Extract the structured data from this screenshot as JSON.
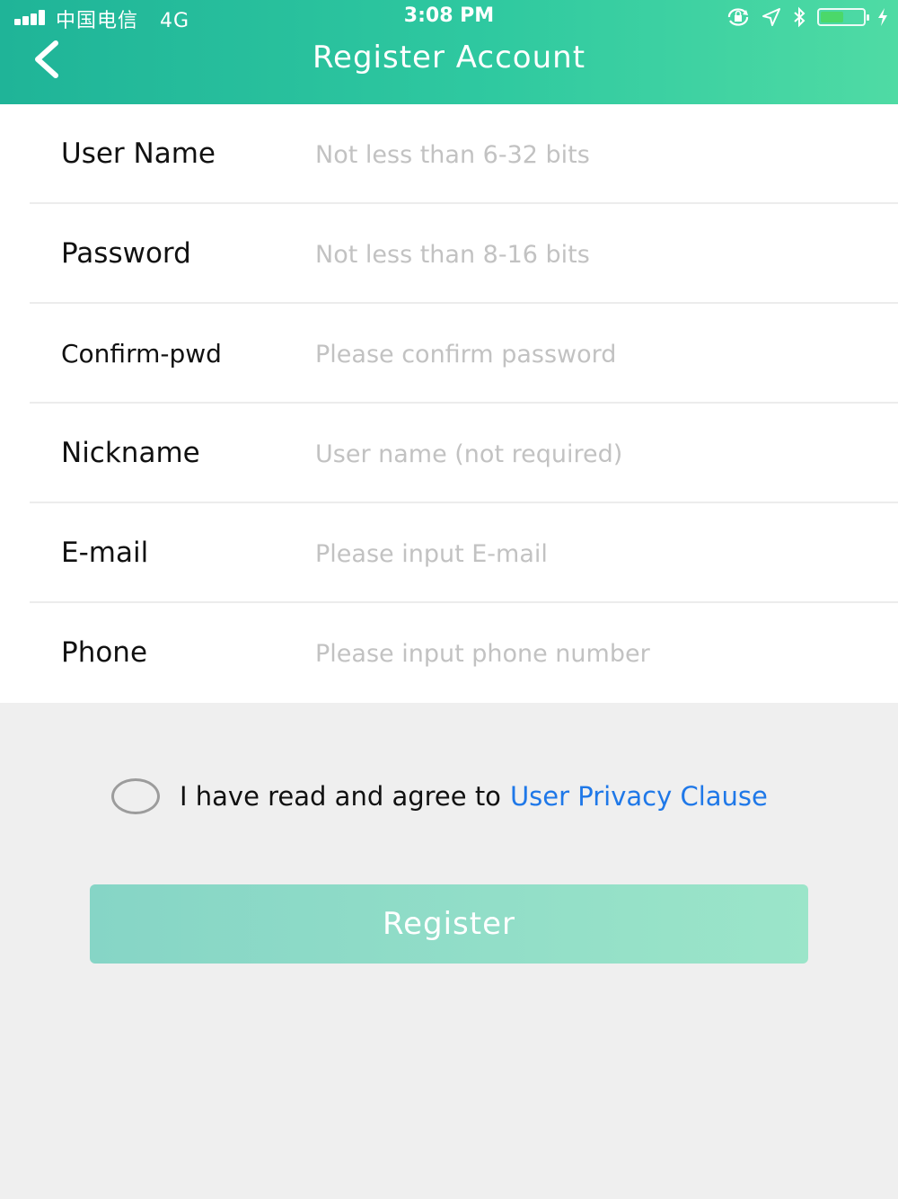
{
  "status_bar": {
    "carrier": "中国电信",
    "network": "4G",
    "time": "3:08 PM",
    "battery_level": 0.55,
    "icons": [
      "signal-icon",
      "orientation-lock-icon",
      "location-arrow-icon",
      "bluetooth-icon",
      "battery-icon",
      "charging-bolt-icon"
    ]
  },
  "header": {
    "title": "Register Account",
    "back_icon": "chevron-left-icon"
  },
  "form": {
    "fields": [
      {
        "label": "User Name",
        "placeholder": "Not less than 6-32 bits",
        "value": ""
      },
      {
        "label": "Password",
        "placeholder": "Not less than 8-16 bits",
        "value": ""
      },
      {
        "label": "Confirm-pwd",
        "placeholder": "Please confirm password",
        "value": ""
      },
      {
        "label": "Nickname",
        "placeholder": "User name (not required)",
        "value": ""
      },
      {
        "label": "E-mail",
        "placeholder": "Please input E-mail",
        "value": ""
      },
      {
        "label": "Phone",
        "placeholder": "Please input phone number",
        "value": ""
      }
    ]
  },
  "agreement": {
    "checked": false,
    "text": "I have read and agree to",
    "link": "User Privacy Clause"
  },
  "register_button": {
    "label": "Register"
  },
  "colors": {
    "header_gradient_start": "#1fb498",
    "header_gradient_end": "#4fdba4",
    "link": "#1f78e8",
    "button_gradient_start": "#86d5c6",
    "button_gradient_end": "#9be5c9",
    "background": "#efefef"
  }
}
